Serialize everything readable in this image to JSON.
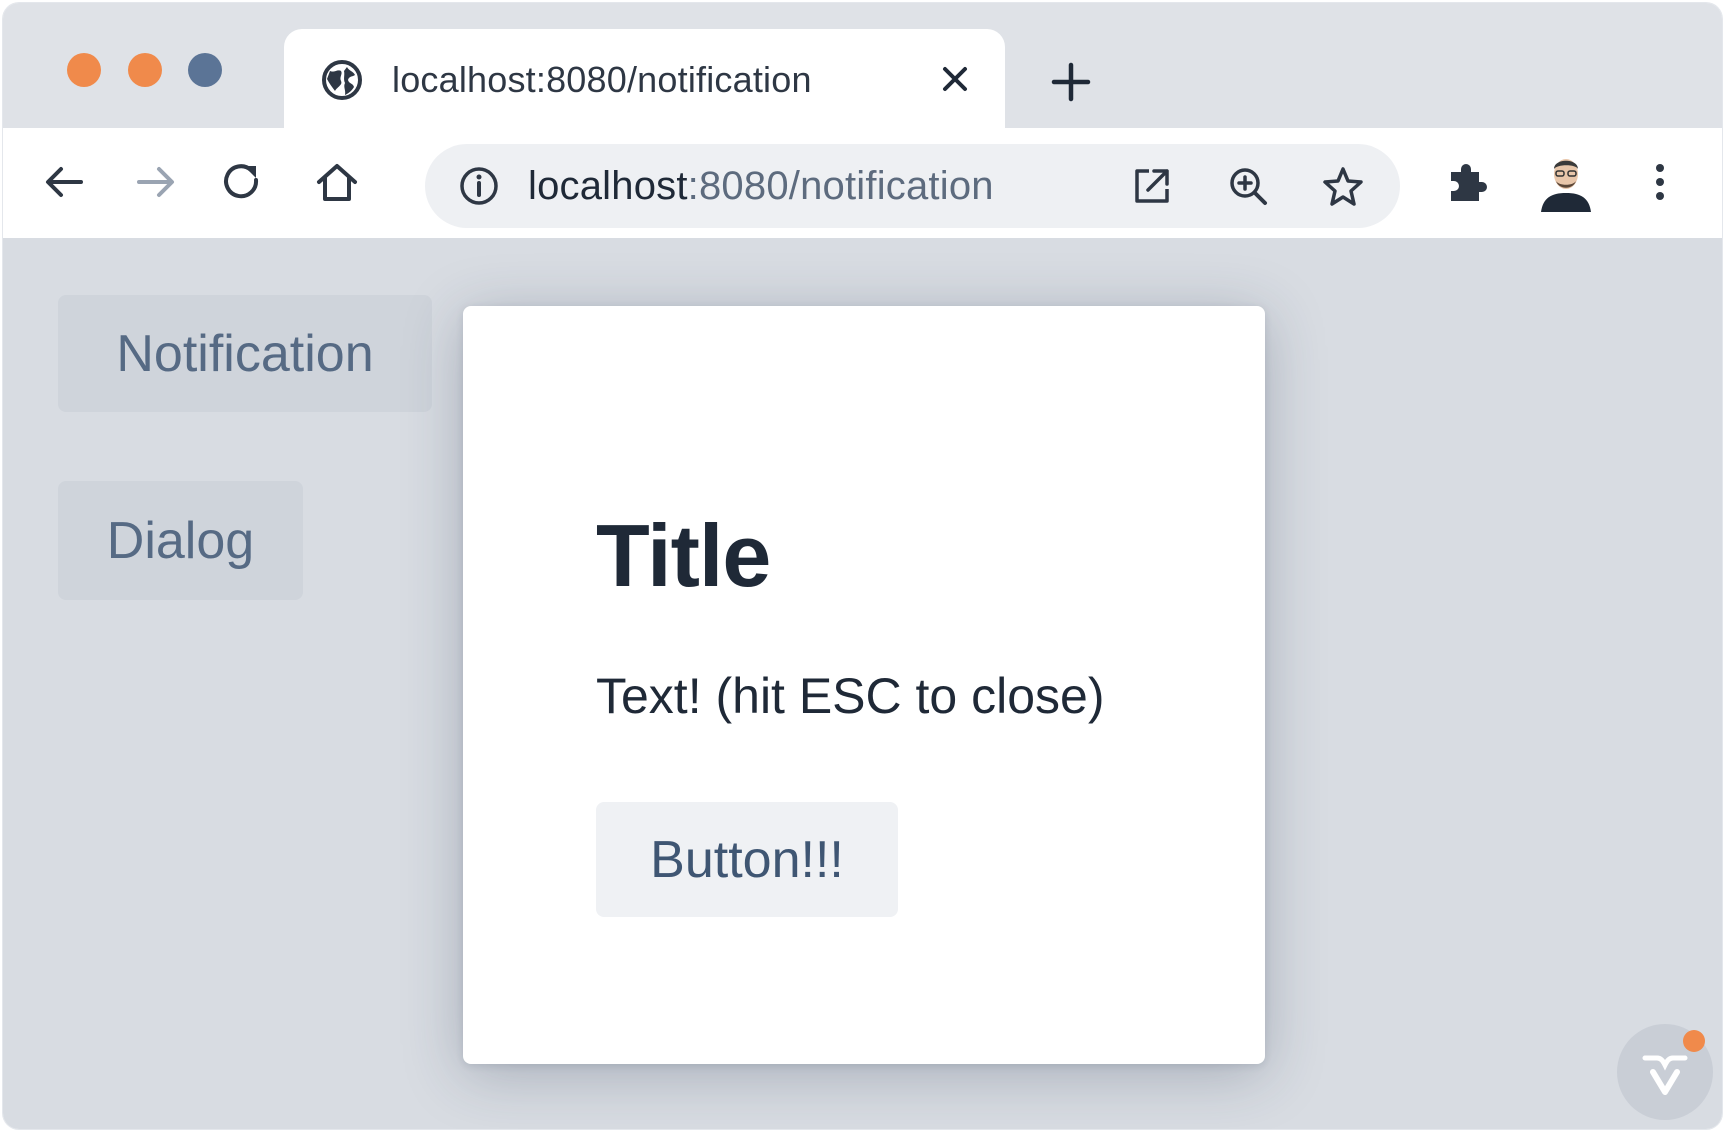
{
  "browser": {
    "tab": {
      "title": "localhost:8080/notification",
      "icon": "globe-icon"
    },
    "toolbar": {
      "back_icon": "arrow-left-icon",
      "forward_icon": "arrow-right-icon",
      "reload_icon": "reload-icon",
      "home_icon": "home-icon",
      "omnibox": {
        "host": "localhost",
        "rest": ":8080/notification",
        "info_icon": "info-icon",
        "open_icon": "external-link-icon",
        "zoom_icon": "zoom-in-icon",
        "bookmark_icon": "star-icon"
      },
      "extensions_icon": "puzzle-icon",
      "profile_icon": "avatar",
      "menu_icon": "kebab-menu-icon"
    },
    "traffic_light_colors": [
      "#f08a4b",
      "#f08a4b",
      "#5b7496"
    ]
  },
  "sidebar": {
    "items": [
      {
        "label": "Notification"
      },
      {
        "label": "Dialog"
      }
    ]
  },
  "dialog": {
    "title": "Title",
    "text": "Text! (hit ESC to close)",
    "button_label": "Button!!!"
  },
  "colors": {
    "page_background": "#d8dce2",
    "accent_orange": "#f08a4b",
    "text_dark": "#1f2937",
    "nav_text": "#566a84"
  }
}
